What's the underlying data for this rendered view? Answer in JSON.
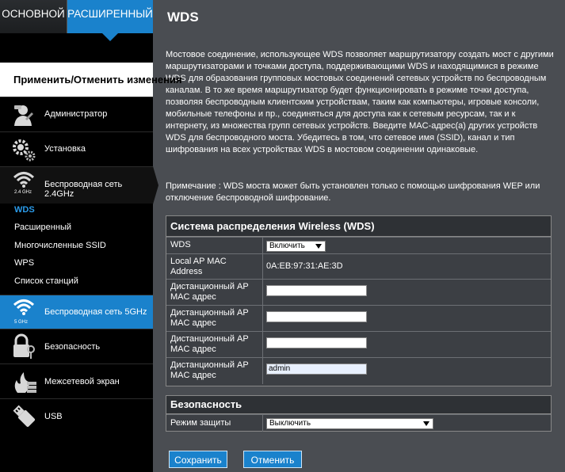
{
  "top_tabs": {
    "basic": "ОСНОВНОЙ",
    "advanced": "РАСШИРЕННЫЙ"
  },
  "apply_label": "Применить/Отменить изменения",
  "nav": {
    "admin": "Администратор",
    "setup": "Установка",
    "wifi24": "Беспроводная сеть 2.4GHz",
    "wifi24_band": "2.4 GHz",
    "sub": [
      "WDS",
      "Расширенный",
      "Многочисленные SSID",
      "WPS",
      "Список станций"
    ],
    "wifi5": "Беспроводная сеть 5GHz",
    "wifi5_band": "5 GHz",
    "security": "Безопасность",
    "firewall": "Межсетевой экран",
    "usb": "USB"
  },
  "page": {
    "title": "WDS",
    "description": "Мостовое соединение, использующее WDS позволяет маршрутизатору создать мост с другими маршрутизаторами и точками доступа, поддерживающими WDS и находящимися в режиме WDS для образования групповых мостовых соединений сетевых устройств по беспроводным каналам. В то же время маршрутизатор будет функционировать в режиме точки доступа, позволяя беспроводным клиентским устройствам, таким как компьютеры, игровые консоли, мобильные телефоны и пр., соединяться для доступа как к сетевым ресурсам, так и к интернету, из множества групп сетевых устройств. Введите MAC-адрес(а) других устройств WDS для беспроводного моста. Убедитесь в том, что сетевое имя (SSID), канал и тип шифрования на всех устройствах WDS в мостовом соединении одинаковые.",
    "note": "Примечание : WDS моста может быть установлен только с помощью шифрования WEP или отключение беспроводной шифрование."
  },
  "wds_panel": {
    "header": "Система распределения Wireless (WDS)",
    "wds_label": "WDS",
    "wds_value": "Включить",
    "local_mac_label": "Local AP MAC Address",
    "local_mac_value": "0A:EB:97:31:AE:3D",
    "remote_label": "Дистанционный AP MAC адрес",
    "remote_values": [
      "",
      "",
      "",
      "admin"
    ]
  },
  "security_panel": {
    "header": "Безопасность",
    "mode_label": "Режим защиты",
    "mode_value": "Выключить"
  },
  "buttons": {
    "save": "Сохранить",
    "cancel": "Отменить"
  },
  "colors": {
    "accent": "#1a82cc",
    "background": "#4a4d52",
    "sidebar": "#000000"
  }
}
